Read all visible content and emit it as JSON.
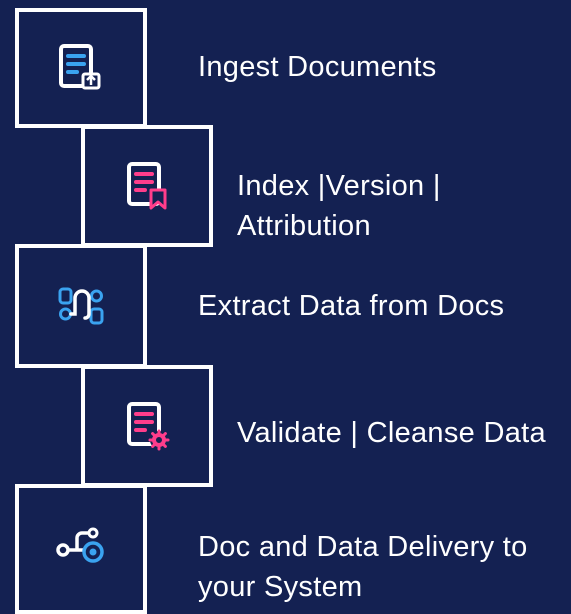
{
  "colors": {
    "background": "#142152",
    "border": "#ffffff",
    "text": "#ffffff",
    "icon_blue": "#3aa3f0",
    "icon_pink": "#ff3d8b",
    "icon_white": "#ffffff"
  },
  "steps": [
    {
      "icon": "document-upload-icon",
      "label_lines": [
        "Ingest Documents"
      ]
    },
    {
      "icon": "document-bookmark-icon",
      "label_lines": [
        "Index |Version |",
        "Attribution"
      ]
    },
    {
      "icon": "data-flow-icon",
      "label_lines": [
        "Extract Data from Docs"
      ]
    },
    {
      "icon": "document-settings-icon",
      "label_lines": [
        "Validate | Cleanse Data"
      ]
    },
    {
      "icon": "delivery-pipeline-icon",
      "label_lines": [
        "Doc and Data Delivery to",
        "your System"
      ]
    }
  ]
}
